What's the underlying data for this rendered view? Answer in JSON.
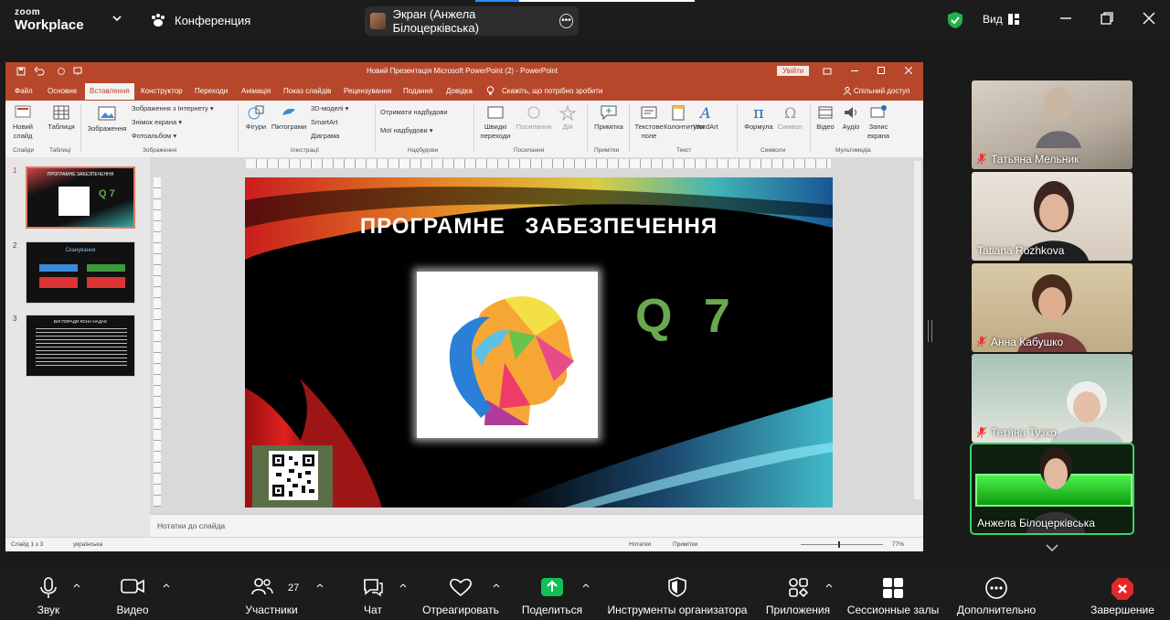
{
  "app": {
    "logo_line1": "zoom",
    "logo_line2": "Workplace",
    "meeting_title": "Конференция"
  },
  "share": {
    "label": "Экран (Анжела Білоцерківська)"
  },
  "top_right": {
    "view_label": "Вид"
  },
  "ppt": {
    "title": "Новий Презентація Microsoft PowerPoint (2)  -  PowerPoint",
    "sign_in": "Увійти",
    "menu": [
      "Файл",
      "Основне",
      "Вставлення",
      "Конструктор",
      "Переходи",
      "Анімація",
      "Показ слайдів",
      "Рецензування",
      "Подання",
      "Довідка"
    ],
    "tell_me": "Скажіть, що потрібно зробити",
    "share_btn": "Спільний доступ",
    "ribbon": {
      "new_slide": "Новий слайд",
      "table": "Таблиця",
      "images": "Зображення",
      "online_images": "Зображення з Інтернету",
      "screenshot": "Знімок екрана",
      "photo_album": "Фотоальбом",
      "shapes": "Фігури",
      "icons": "Піктограми",
      "models3d": "3D-моделі",
      "smartart": "SmartArt",
      "chart": "Діаграма",
      "get_addins": "Отримати надбудови",
      "my_addins": "Мої надбудови",
      "quick_links": "Швидкі переходи",
      "link": "Посилання",
      "action": "Дія",
      "comment": "Примітка",
      "textbox": "Текстове поле",
      "header_footer": "Колонтитули",
      "wordart": "WordArt",
      "equation": "Формула",
      "symbol": "Символ",
      "video": "Відео",
      "audio": "Аудіо",
      "screen_rec": "Запис екрана",
      "groups": [
        "Слайди",
        "Таблиці",
        "Зображення",
        "Ілюстрації",
        "Надбудови",
        "Посилання",
        "Примітки",
        "Текст",
        "Символи",
        "Мультимедіа"
      ]
    },
    "slides": [
      {
        "num": "1",
        "title": "ПРОГРАМНЕ  ЗАБЕЗПЕЧЕННЯ",
        "q": "Q 7"
      },
      {
        "num": "2",
        "title": "Сканування"
      },
      {
        "num": "3",
        "title": "ВІЛ ПОРАДИ ЯСНА НАДАЄ"
      }
    ],
    "current_slide": {
      "title": "ПРОГРАМНЕ ЗАБЕЗПЕЧЕННЯ",
      "q_label": "Q 7"
    },
    "notes_placeholder": "Нотатки до слайда",
    "status": {
      "slide_of": "Слайд 1 з 3",
      "language": "українська",
      "notes": "Нотатки",
      "comments": "Примітки",
      "zoom": "77%"
    }
  },
  "participants": [
    {
      "name": "Татьяна Мельник",
      "muted": true
    },
    {
      "name": "Tatiana Rozhkova",
      "muted": false
    },
    {
      "name": "Анна Кабушко",
      "muted": true
    },
    {
      "name": "Тетяна Тузко",
      "muted": true
    },
    {
      "name": "Анжела Білоцерківська",
      "muted": false
    }
  ],
  "toolbar": {
    "audio": "Звук",
    "video": "Видео",
    "participants": "Участники",
    "participants_count": "27",
    "chat": "Чат",
    "react": "Отреагировать",
    "share": "Поделиться",
    "host_tools": "Инструменты организатора",
    "apps": "Приложения",
    "breakout": "Сессионные залы",
    "more": "Дополнительно",
    "end": "Завершение"
  },
  "colors": {
    "ppt_accent": "#b7472a",
    "zoom_share": "#0fc056",
    "q7_green": "#6aa84f",
    "end_red": "#e02828"
  }
}
